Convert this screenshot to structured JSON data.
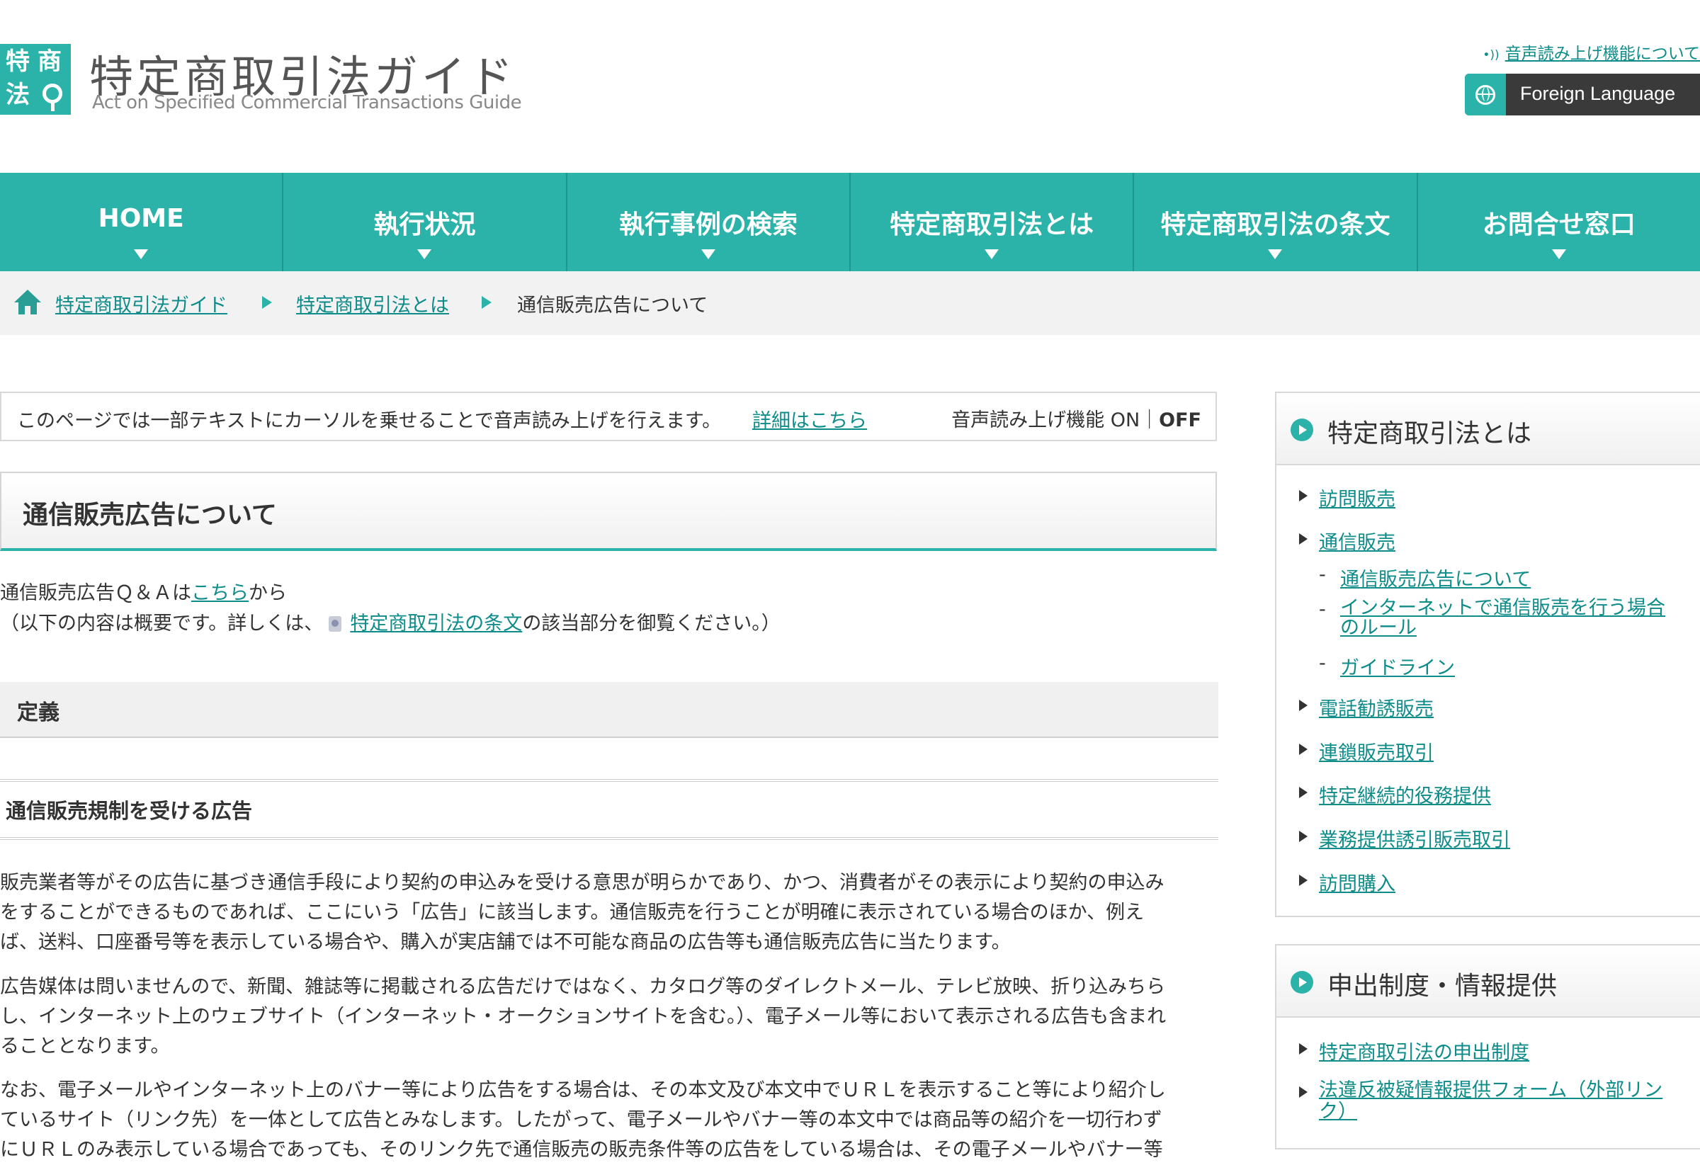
{
  "header": {
    "logo_chars": [
      "特",
      "商",
      "法"
    ],
    "site_title": "特定商取引法ガイド",
    "site_subtitle": "Act on Specified Commercial Transactions Guide",
    "tts_info_link": "音声読み上げ機能について",
    "foreign_language": "Foreign Language"
  },
  "nav": {
    "items": [
      "HOME",
      "執行状況",
      "執行事例の検索",
      "特定商取引法とは",
      "特定商取引法の条文",
      "お問合せ窓口"
    ]
  },
  "breadcrumb": {
    "items": [
      "特定商取引法ガイド",
      "特定商取引法とは",
      "通信販売広告について"
    ]
  },
  "tts_bar": {
    "message": "このページでは一部テキストにカーソルを乗せることで音声読み上げを行えます。",
    "details_link": "詳細はこちら",
    "state_prefix": "音声読み上げ機能 ON｜",
    "state_off": "OFF"
  },
  "page": {
    "title": "通信販売広告について",
    "qa_prefix": "通信販売広告Ｑ＆Ａは",
    "qa_link": "こちら",
    "qa_suffix": "から",
    "note_prefix": "（以下の内容は概要です。詳しくは、",
    "note_link": "特定商取引法の条文",
    "note_suffix": "の該当部分を御覧ください。）",
    "section_definition": "定義",
    "subsection_title": "通信販売規制を受ける広告",
    "paragraphs": [
      [
        "販売業者等がその広告に基づき通信手段により契約の申込みを受ける意思が明らかであり、かつ、消費者がその表示により契約の申込み",
        "をすることができるものであれば、ここにいう「広告」に該当します。通信販売を行うことが明確に表示されている場合のほか、例え",
        "ば、送料、口座番号等を表示している場合や、購入が実店舗では不可能な商品の広告等も通信販売広告に当たります。"
      ],
      [
        "広告媒体は問いませんので、新聞、雑誌等に掲載される広告だけではなく、カタログ等のダイレクトメール、テレビ放映、折り込みちら",
        "し、インターネット上のウェブサイト（インターネット・オークションサイトを含む。）、電子メール等において表示される広告も含まれ",
        "ることとなります。"
      ],
      [
        "なお、電子メールやインターネット上のバナー等により広告をする場合は、その本文及び本文中でＵＲＬを表示すること等により紹介し",
        "ているサイト（リンク先）を一体として広告とみなします。したがって、電子メールやバナー等の本文中では商品等の紹介を一切行わず",
        "にＵＲＬのみ表示している場合であっても、そのリンク先で通信販売の販売条件等の広告をしている場合は、その電子メールやバナー等"
      ]
    ]
  },
  "sidebar": {
    "box1": {
      "title": "特定商取引法とは",
      "items": [
        "訪問販売",
        "通信販売",
        "電話勧誘販売",
        "連鎖販売取引",
        "特定継続的役務提供",
        "業務提供誘引販売取引",
        "訪問購入"
      ],
      "subitems": [
        "通信販売広告について",
        "インターネットで通信販売を行う場合",
        "のルール",
        "ガイドライン"
      ]
    },
    "box2": {
      "title": "申出制度・情報提供",
      "items": [
        "特定商取引法の申出制度",
        "法違反被疑情報提供フォーム（外部リン",
        "ク）"
      ]
    }
  },
  "colors": {
    "accent": "#2bb3aa",
    "link": "#0e8c8a",
    "dark_button": "#3a3a3a",
    "text": "#333333"
  }
}
